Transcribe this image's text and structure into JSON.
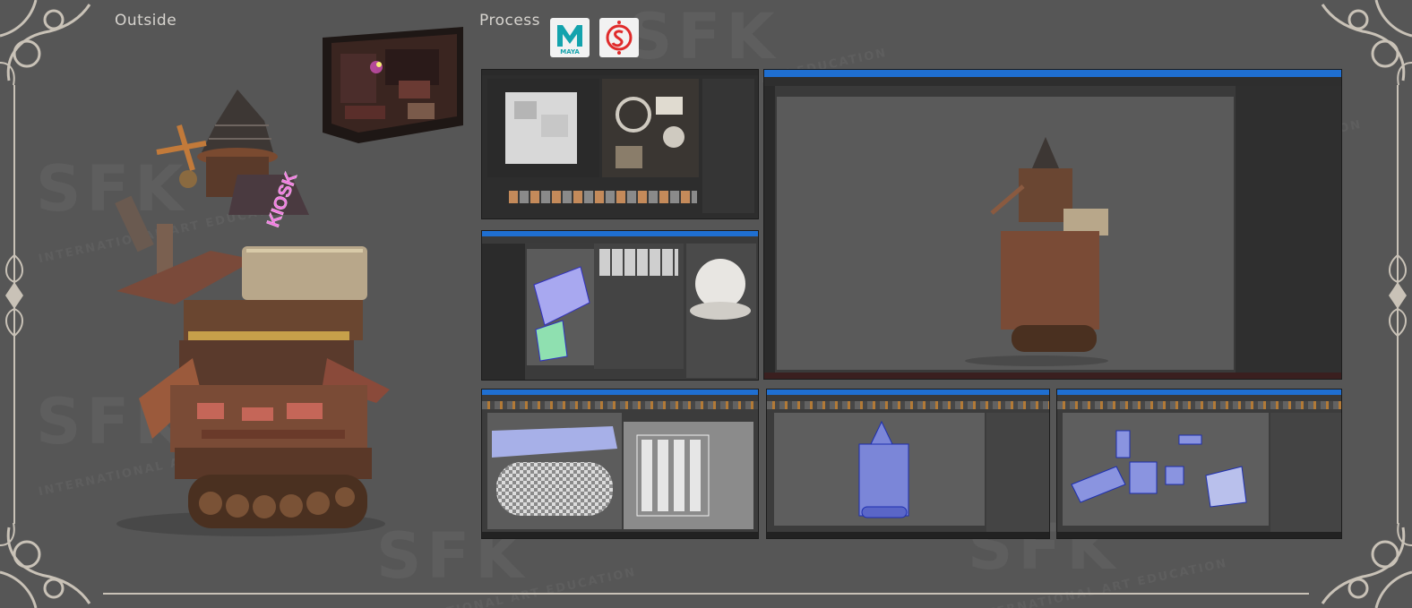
{
  "sections": {
    "outside_title": "Outside",
    "process_title": "Process"
  },
  "apps": {
    "maya_label": "MAYA",
    "maya_letter": "M"
  },
  "model_sign": "KIOSK",
  "watermark": {
    "logo_text": "SFK",
    "sub_text": "INTERNATIONAL ART EDUCATION"
  },
  "colors": {
    "background": "#565656",
    "frame_ornament": "#c9c2b7",
    "maya_teal": "#14a3ad",
    "substance_red": "#e02b2b",
    "window_titlebar": "#1f6fd1"
  }
}
